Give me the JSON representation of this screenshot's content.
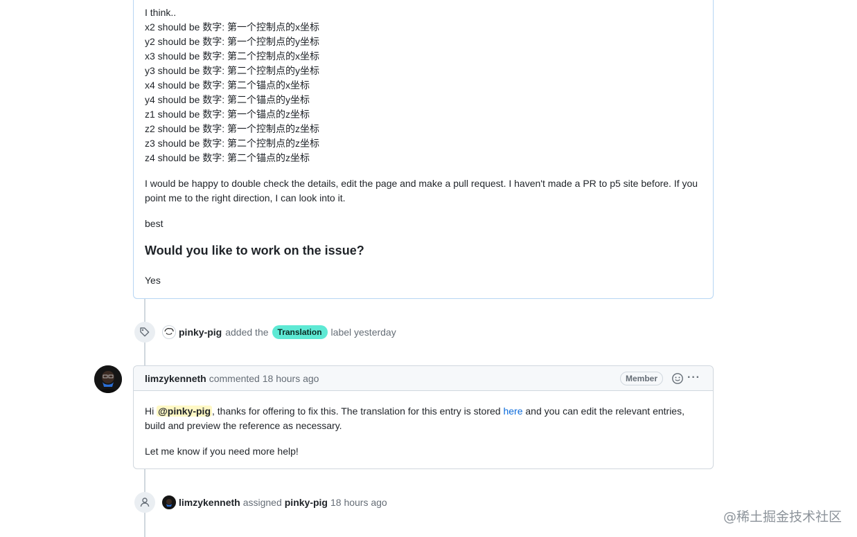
{
  "first_comment": {
    "lines": [
      "I think..",
      "x2 should be 数字: 第一个控制点的x坐标",
      "y2 should be 数字: 第一个控制点的y坐标",
      "x3 should be 数字: 第二个控制点的x坐标",
      "y3 should be 数字: 第二个控制点的y坐标",
      "x4 should be 数字: 第二个锚点的x坐标",
      "y4 should be 数字: 第二个锚点的y坐标",
      "z1 should be 数字: 第一个锚点的z坐标",
      "z2 should be 数字: 第一个控制点的z坐标",
      "z3 should be 数字: 第二个控制点的z坐标",
      "z4 should be 数字: 第二个锚点的z坐标"
    ],
    "para1_line1": "I would be happy to double check the details, edit the page and make a pull request. I haven't made a PR to p5 site before. If you",
    "para1_line2": "point me to the right direction, I can look into it.",
    "sign_off": "best",
    "heading": "Would you like to work on the issue?",
    "answer": "Yes"
  },
  "label_event": {
    "actor": "pinky-pig",
    "action": "added the",
    "label": "Translation",
    "label_color": "#5ee9d4",
    "suffix": "label yesterday",
    "icon": "tag-icon"
  },
  "second_comment": {
    "author": "limzykenneth",
    "meta": "commented 18 hours ago",
    "badge": "Member",
    "body_hi": "Hi ",
    "mention": "@pinky-pig",
    "body_part1": ", thanks for offering to fix this. The translation for this entry is stored ",
    "link_text": "here",
    "body_part2": " and you can edit the relevant entries,",
    "body_line2": "build and preview the reference as necessary.",
    "body_para2": "Let me know if you need more help!"
  },
  "assign_event": {
    "actor": "limzykenneth",
    "action": "assigned",
    "assignee": "pinky-pig",
    "time": "18 hours ago",
    "icon": "person-icon"
  },
  "watermark": "@稀土掘金技术社区"
}
